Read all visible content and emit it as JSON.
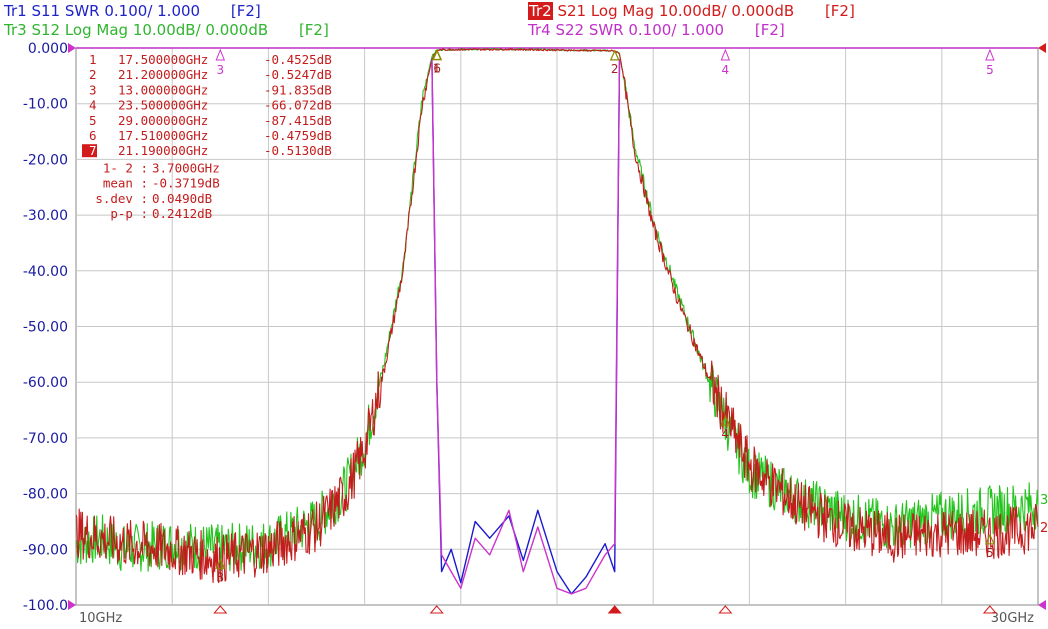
{
  "traces": [
    {
      "id": "tr1",
      "tag": "Tr1",
      "label": "S11 SWR 0.100/ 1.000",
      "fkey": "[F2]",
      "color": "#1f23c8",
      "badge": false
    },
    {
      "id": "tr2",
      "tag": "Tr2",
      "label": "S21 Log Mag 10.00dB/ 0.000dB",
      "fkey": "[F2]",
      "color": "#d31b1b",
      "badge": true
    },
    {
      "id": "tr3",
      "tag": "Tr3",
      "label": "S12 Log Mag 10.00dB/ 0.000dB",
      "fkey": "[F2]",
      "color": "#2fb52f",
      "badge": false
    },
    {
      "id": "tr4",
      "tag": "Tr4",
      "label": "S22 SWR 0.100/ 1.000",
      "fkey": "[F2]",
      "color": "#c030c8",
      "badge": false
    }
  ],
  "colors": {
    "red": "#c41c1c",
    "green": "#22c41c",
    "blue": "#1a1ad0",
    "magenta": "#cc33cc",
    "grid": "#c8c8c8",
    "axis_text": "#1a1aa0"
  },
  "chart_data": {
    "type": "line",
    "title": "",
    "xlabel": "",
    "ylabel": "",
    "xlim": [
      10,
      30
    ],
    "ylim": [
      -100,
      0
    ],
    "x_unit": "GHz",
    "x_tick_labels": [
      "10GHz",
      "30GHz"
    ],
    "y_tick_labels": [
      "0.000",
      "-10.00",
      "-20.00",
      "-30.00",
      "-40.00",
      "-50.00",
      "-60.00",
      "-70.00",
      "-80.00",
      "-90.00",
      "-100.0"
    ],
    "grid": true,
    "series": [
      {
        "name": "Tr2 S21",
        "color": "red",
        "x": [
          10,
          10.5,
          11,
          12,
          13,
          14,
          15,
          15.6,
          16,
          16.4,
          16.8,
          17,
          17.2,
          17.4,
          17.5,
          17.6,
          19,
          21.2,
          21.3,
          21.4,
          21.6,
          22,
          22.5,
          23,
          23.5,
          24,
          25,
          26,
          27,
          28,
          29,
          30
        ],
        "y": [
          -87,
          -88,
          -89,
          -90,
          -91.8,
          -90,
          -86,
          -80,
          -72,
          -58,
          -40,
          -25,
          -10,
          -2,
          -0.45,
          -0.3,
          -0.25,
          -0.52,
          -1,
          -6,
          -18,
          -32,
          -45,
          -56,
          -66,
          -75,
          -82,
          -86,
          -88,
          -87,
          -87.4,
          -86
        ]
      },
      {
        "name": "Tr3 S12",
        "color": "green",
        "x": [
          10,
          10.5,
          11,
          12,
          13,
          14,
          15,
          15.6,
          16,
          16.4,
          16.8,
          17,
          17.2,
          17.4,
          17.5,
          17.6,
          19,
          21.2,
          21.3,
          21.4,
          21.6,
          22,
          22.5,
          23,
          23.5,
          24,
          25,
          26,
          27,
          28,
          29,
          30
        ],
        "y": [
          -89,
          -88,
          -90,
          -89,
          -90,
          -89,
          -85,
          -79,
          -71,
          -57,
          -39,
          -24,
          -9,
          -1.5,
          -0.4,
          -0.3,
          -0.2,
          -0.5,
          -1,
          -6,
          -17,
          -31,
          -44,
          -56,
          -67,
          -76,
          -81,
          -84,
          -86,
          -84,
          -83,
          -82
        ]
      },
      {
        "name": "Tr1 S11",
        "color": "blue",
        "x": [
          17.4,
          17.5,
          17.6,
          17.8,
          18,
          18.3,
          18.6,
          19,
          19.3,
          19.6,
          20,
          20.3,
          20.6,
          21,
          21.2,
          21.3
        ],
        "y": [
          -2,
          -60,
          -94,
          -90,
          -96,
          -85,
          -88,
          -84,
          -92,
          -83,
          -94,
          -98,
          -95,
          -89,
          -94,
          -2
        ]
      },
      {
        "name": "Tr4 S22",
        "color": "magenta",
        "x": [
          17.4,
          17.5,
          17.6,
          17.8,
          18,
          18.3,
          18.6,
          19,
          19.3,
          19.6,
          20,
          20.3,
          20.6,
          21,
          21.2,
          21.3
        ],
        "y": [
          -2,
          -60,
          -91,
          -94,
          -97,
          -88,
          -91,
          -83,
          -94,
          -86,
          -97,
          -98,
          -97,
          -91,
          -89,
          -2
        ]
      }
    ],
    "marker_table": [
      {
        "num": "1",
        "freq": "17.500000GHz",
        "val": "-0.4525dB",
        "active": false
      },
      {
        "num": "2",
        "freq": "21.200000GHz",
        "val": "-0.5247dB",
        "active": false
      },
      {
        "num": "3",
        "freq": "13.000000GHz",
        "val": "-91.835dB",
        "active": false
      },
      {
        "num": "4",
        "freq": "23.500000GHz",
        "val": "-66.072dB",
        "active": false
      },
      {
        "num": "5",
        "freq": "29.000000GHz",
        "val": "-87.415dB",
        "active": false
      },
      {
        "num": "6",
        "freq": "17.510000GHz",
        "val": "-0.4759dB",
        "active": false
      },
      {
        "num": "7",
        "freq": "21.190000GHz",
        "val": "-0.5130dB",
        "active": true
      }
    ],
    "stats": [
      {
        "label": "1- 2 :",
        "value": "3.7000GHz"
      },
      {
        "label": "mean :",
        "value": "-0.3719dB"
      },
      {
        "label": "s.dev :",
        "value": "0.0490dB"
      },
      {
        "label": "p-p :",
        "value": "0.2412dB"
      }
    ],
    "markers": [
      {
        "label": "1",
        "x": 17.5,
        "y": -0.45
      },
      {
        "label": "6",
        "x": 17.51,
        "y": -0.48
      },
      {
        "label": "2",
        "x": 21.2,
        "y": -0.52
      },
      {
        "label": "3",
        "x": 13,
        "y": -91.8
      },
      {
        "label": "4",
        "x": 23.5,
        "y": -66.1
      },
      {
        "label": "5",
        "x": 29,
        "y": -87.4
      }
    ],
    "top_markers": [
      {
        "label": "3",
        "x": 13
      },
      {
        "label": "4",
        "x": 23.5
      },
      {
        "label": "5",
        "x": 29
      }
    ],
    "bottom_markers": [
      {
        "x": 13
      },
      {
        "x": 17.5
      },
      {
        "x": 21.2,
        "filled": true
      },
      {
        "x": 23.5
      },
      {
        "x": 29
      }
    ],
    "right_labels": [
      {
        "label": "3",
        "color": "green",
        "y": -81
      },
      {
        "label": "2",
        "color": "red",
        "y": -86
      }
    ]
  }
}
